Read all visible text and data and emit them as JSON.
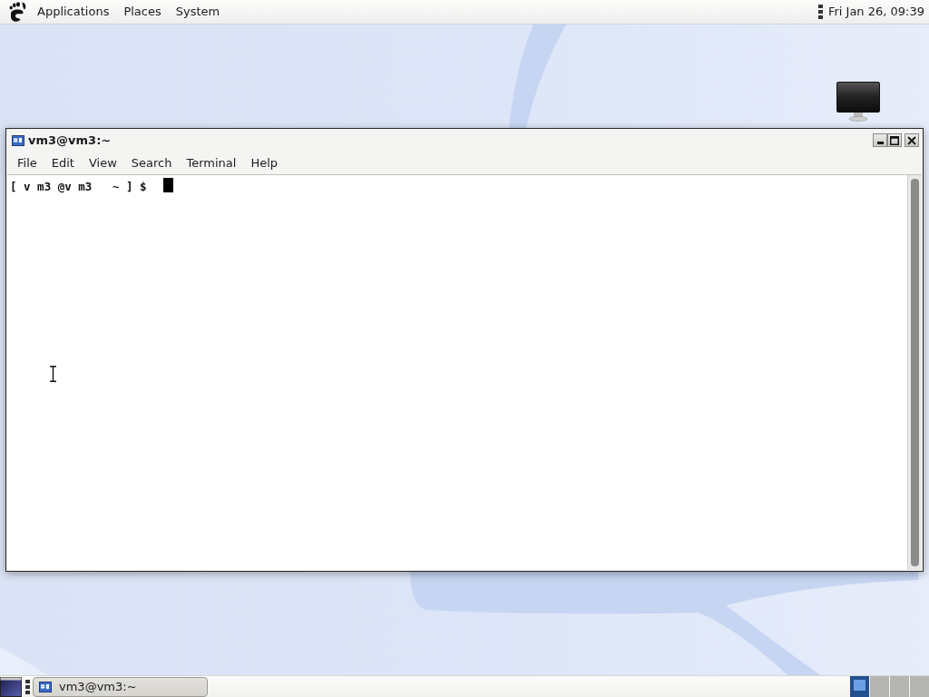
{
  "top_panel": {
    "menus": [
      "Applications",
      "Places",
      "System"
    ],
    "clock": "Fri Jan 26, 09:39"
  },
  "window": {
    "title": "vm3@vm3:~",
    "menus": [
      "File",
      "Edit",
      "View",
      "Search",
      "Terminal",
      "Help"
    ],
    "terminal": {
      "prompt": "[ v m3 @v m3   ~ ] $"
    }
  },
  "bottom_panel": {
    "tasks": [
      {
        "label": "vm3@vm3:~",
        "selected": false
      }
    ],
    "workspaces": [
      {
        "selected": true
      },
      {
        "selected": false
      },
      {
        "selected": false
      },
      {
        "selected": false
      }
    ]
  }
}
